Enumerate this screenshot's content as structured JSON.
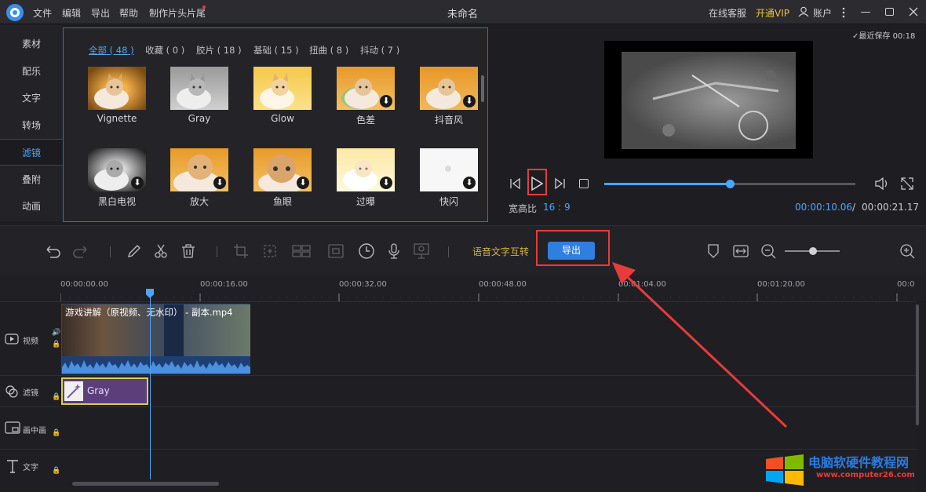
{
  "app": {
    "title": "未命名",
    "menu": [
      "文件",
      "编辑",
      "导出",
      "帮助",
      "制作片头片尾"
    ],
    "right": {
      "service": "在线客服",
      "vip": "开通VIP",
      "account": "账户"
    }
  },
  "left_tabs": [
    "素材",
    "配乐",
    "文字",
    "转场",
    "滤镜",
    "叠附",
    "动画"
  ],
  "filter_tabs": [
    "全部 ( 48 )",
    "收藏 ( 0 )",
    "胶片 ( 18 )",
    "基础 ( 15 )",
    "扭曲 ( 8 )",
    "抖动 ( 7 )"
  ],
  "filters": [
    {
      "label": "Vignette",
      "download": false
    },
    {
      "label": "Gray",
      "download": false
    },
    {
      "label": "Glow",
      "download": false
    },
    {
      "label": "色差",
      "download": true
    },
    {
      "label": "抖音风",
      "download": true
    },
    {
      "label": "黑白电视",
      "download": true
    },
    {
      "label": "放大",
      "download": true
    },
    {
      "label": "鱼眼",
      "download": true
    },
    {
      "label": "过曝",
      "download": true
    },
    {
      "label": "快闪",
      "download": true
    }
  ],
  "preview": {
    "saved": "最近保存 00:18",
    "aspect_label": "宽高比",
    "aspect_value": "16 : 9",
    "time_current": "00:00:10.06",
    "time_sep": "/",
    "time_total": "00:00:21.17",
    "progress": 0.5
  },
  "toolbar": {
    "speech_label": "语音文字互转",
    "export_label": "导出"
  },
  "timeline": {
    "ticks": [
      "00:00:00.00",
      "00:00:16.00",
      "00:00:32.00",
      "00:00:48.00",
      "00:01:04.00",
      "00:01:20.00",
      "00:0"
    ],
    "tracks": [
      "视频",
      "滤镜",
      "画中画",
      "文字"
    ],
    "video_clip": "游戏讲解（原视频、无水印） - 副本.mp4",
    "filter_clip": "Gray"
  },
  "watermark": {
    "site": "电脑软硬件教程网",
    "url": "www.computer26.com"
  },
  "colors": {
    "accent": "#4aa6ff",
    "export_button": "#2f7fe0",
    "highlight": "#e83b3b",
    "vip": "#f0c23b"
  }
}
